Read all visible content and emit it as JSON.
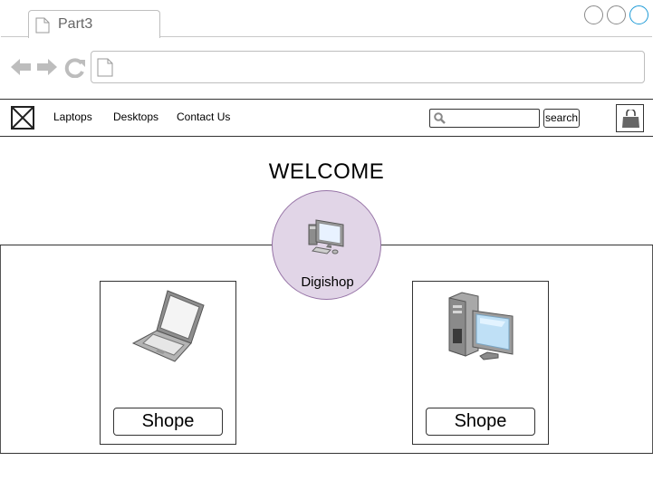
{
  "browser": {
    "tab_title": "Part3",
    "url": ""
  },
  "site_nav": {
    "links": [
      {
        "label": "Laptops"
      },
      {
        "label": "Desktops"
      },
      {
        "label": "Contact Us"
      }
    ],
    "search_placeholder": "",
    "search_button_label": "search"
  },
  "hero": {
    "title": "WELCOME",
    "brand_name": "Digishop"
  },
  "products": [
    {
      "icon": "laptop-icon",
      "button_label": "Shope"
    },
    {
      "icon": "desktop-computer-icon",
      "button_label": "Shope"
    }
  ],
  "colors": {
    "brand_circle_fill": "#e1d5e7",
    "brand_circle_border": "#9673a6",
    "window_accent": "#1e9bd7"
  }
}
